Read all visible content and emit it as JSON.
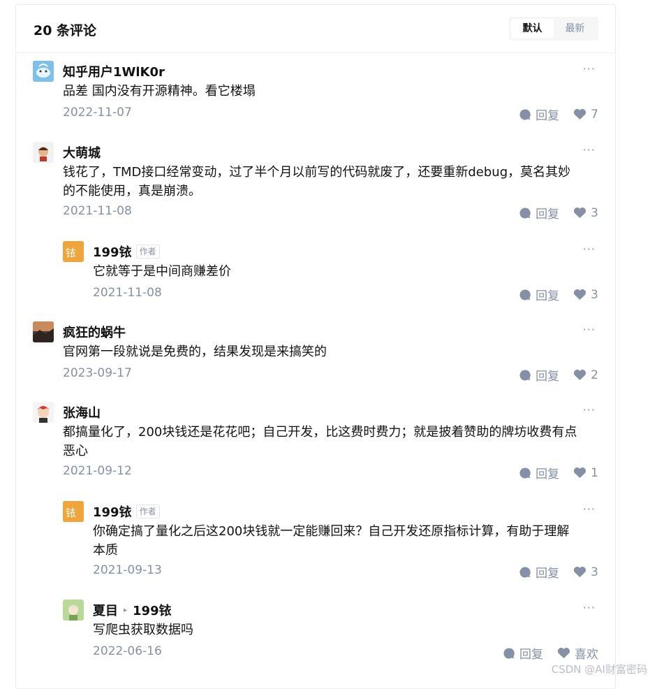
{
  "header": {
    "title": "20 条评论",
    "sort_default": "默认",
    "sort_latest": "最新"
  },
  "actions": {
    "reply": "回复",
    "like_text": "喜欢"
  },
  "comments": [
    {
      "name": "知乎用户1WlK0r",
      "content": "品差 国内没有开源精神。看它楼塌",
      "date": "2022-11-07",
      "likes": "7"
    },
    {
      "name": "大萌城",
      "content_line1": "钱花了，TMD接口经常变动，过了半个月以前写的代码就废了，还要重新debug，莫名其妙",
      "content_line2": "的不能使用，真是崩溃。",
      "date": "2021-11-08",
      "likes": "3"
    },
    {
      "name": "199铱",
      "tag": "作者",
      "content": "它就等于是中间商赚差价",
      "date": "2021-11-08",
      "likes": "3"
    },
    {
      "name": "疯狂的蜗牛",
      "content": "官网第一段就说是免费的，结果发现是来搞笑的",
      "date": "2023-09-17",
      "likes": "2"
    },
    {
      "name": "张海山",
      "content_line1": "都搞量化了，200块钱还是花花吧；自己开发，比这费时费力；就是披着赞助的牌坊收费有点",
      "content_line2": "恶心",
      "date": "2021-09-12",
      "likes": "1"
    },
    {
      "name": "199铱",
      "tag": "作者",
      "content_line1": "你确定搞了量化之后这200块钱就一定能赚回来？自己开发还原指标计算，有助于理解",
      "content_line2": "本质",
      "date": "2021-09-13",
      "likes": "3"
    },
    {
      "name": "夏目",
      "reply_to": "199铱",
      "content": "写爬虫获取数据吗",
      "date": "2022-06-16"
    }
  ],
  "avatar_glyph": "铱",
  "watermark": "CSDN @AI财富密码",
  "colors": {
    "muted": "#8590a6",
    "text": "#121212",
    "author_avatar": "#f0a53c"
  }
}
